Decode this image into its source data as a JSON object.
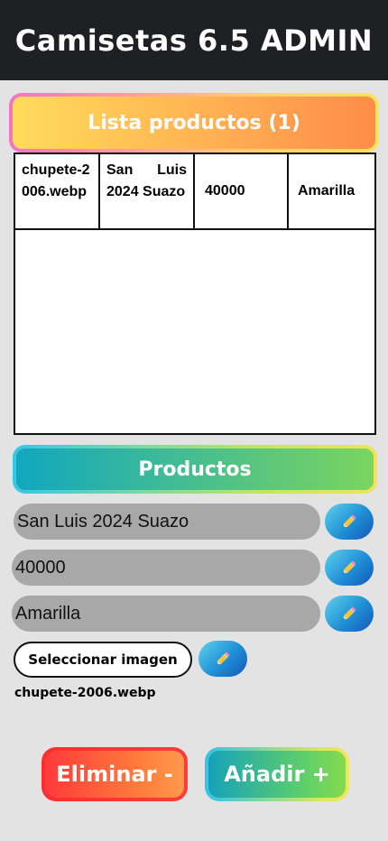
{
  "header": {
    "title": "Camisetas 6.5 ADMIN"
  },
  "product_list": {
    "title": "Lista productos (1)",
    "rows": [
      {
        "image": "chupete-2006.webp",
        "name": "San Luis 2024 Suazo",
        "price": "40000",
        "color": "Amarilla"
      }
    ]
  },
  "form": {
    "title": "Productos",
    "name_value": "San Luis 2024 Suazo",
    "price_value": "40000",
    "color_value": "Amarilla",
    "select_image_label": "Seleccionar imagen",
    "selected_file": "chupete-2006.webp",
    "edit_icon": "pencil-icon"
  },
  "actions": {
    "delete_label": "Eliminar -",
    "add_label": "Añadir +"
  }
}
